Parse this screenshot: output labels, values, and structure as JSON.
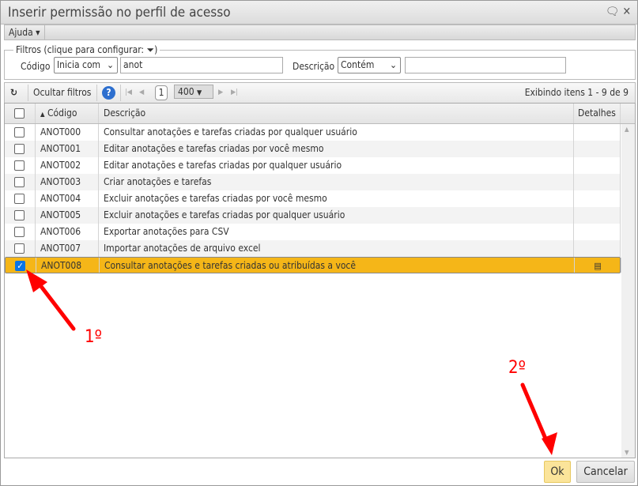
{
  "dialog": {
    "title": "Inserir permissão no perfil de acesso",
    "icons": [
      "comment-icon",
      "close-icon"
    ]
  },
  "menu": {
    "help": "Ajuda ▾"
  },
  "filters": {
    "legend": "Filtros (clique para configurar:",
    "legend_end": ")",
    "code_label": "Código",
    "code_op": "Inicia com",
    "code_value": "anot",
    "desc_label": "Descrição",
    "desc_op": "Contém",
    "desc_value": ""
  },
  "toolbar": {
    "hide_filters": "Ocultar filtros",
    "page": "1",
    "page_size": "400",
    "status": "Exibindo itens 1 - 9 de 9"
  },
  "grid": {
    "columns": [
      "Código",
      "Descrição",
      "Detalhes"
    ],
    "rows": [
      {
        "code": "ANOT000",
        "desc": "Consultar anotações e tarefas criadas por qualquer usuário",
        "checked": false
      },
      {
        "code": "ANOT001",
        "desc": "Editar anotações e tarefas criadas por você mesmo",
        "checked": false
      },
      {
        "code": "ANOT002",
        "desc": "Editar anotações e tarefas criadas por qualquer usuário",
        "checked": false
      },
      {
        "code": "ANOT003",
        "desc": "Criar anotações e tarefas",
        "checked": false
      },
      {
        "code": "ANOT004",
        "desc": "Excluir anotações e tarefas criadas por você mesmo",
        "checked": false
      },
      {
        "code": "ANOT005",
        "desc": "Excluir anotações e tarefas criadas por qualquer usuário",
        "checked": false
      },
      {
        "code": "ANOT006",
        "desc": "Exportar anotações para CSV",
        "checked": false
      },
      {
        "code": "ANOT007",
        "desc": "Importar anotações de arquivo excel",
        "checked": false
      },
      {
        "code": "ANOT008",
        "desc": "Consultar anotações e tarefas criadas ou atribuídas a você",
        "checked": true
      }
    ]
  },
  "buttons": {
    "ok": "Ok",
    "cancel": "Cancelar"
  },
  "annotations": {
    "step1": "1º",
    "step2": "2º"
  },
  "colors": {
    "selected_row": "#f5b618",
    "annotation": "#ff0000",
    "ok_button": "#fbe49a"
  }
}
